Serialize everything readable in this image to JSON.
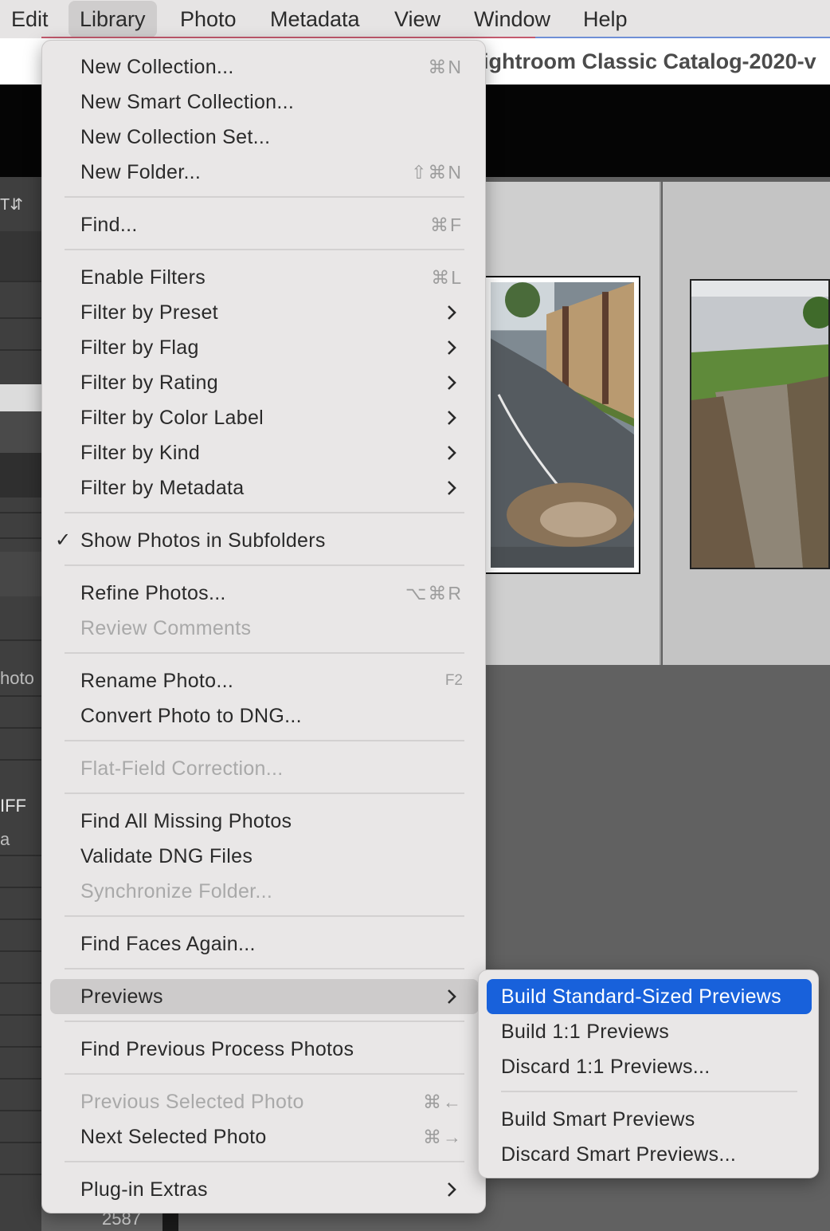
{
  "menubar": {
    "items": [
      {
        "label": "Edit"
      },
      {
        "label": "Library"
      },
      {
        "label": "Photo"
      },
      {
        "label": "Metadata"
      },
      {
        "label": "View"
      },
      {
        "label": "Window"
      },
      {
        "label": "Help"
      }
    ],
    "active": "Library"
  },
  "window": {
    "title": "ightroom Classic Catalog-2020-v"
  },
  "background": {
    "left_panel_texts": [
      "hoto",
      "IFF",
      "a"
    ],
    "filmstrip_count": "2587"
  },
  "library_menu": {
    "items": [
      {
        "label": "New Collection...",
        "shortcut": "⌘N"
      },
      {
        "label": "New Smart Collection..."
      },
      {
        "label": "New Collection Set..."
      },
      {
        "label": "New Folder...",
        "shortcut": "⇧⌘N"
      },
      {
        "label": "Find...",
        "shortcut": "⌘F"
      },
      {
        "label": "Enable Filters",
        "shortcut": "⌘L"
      },
      {
        "label": "Filter by Preset"
      },
      {
        "label": "Filter by Flag"
      },
      {
        "label": "Filter by Rating"
      },
      {
        "label": "Filter by Color Label"
      },
      {
        "label": "Filter by Kind"
      },
      {
        "label": "Filter by Metadata"
      },
      {
        "label": "Show Photos in Subfolders",
        "checked": true,
        "check_mark": "✓"
      },
      {
        "label": "Refine Photos...",
        "shortcut": "⌥⌘R"
      },
      {
        "label": "Review Comments",
        "disabled": true
      },
      {
        "label": "Rename Photo...",
        "shortcut": "F2"
      },
      {
        "label": "Convert Photo to DNG..."
      },
      {
        "label": "Flat-Field Correction...",
        "disabled": true
      },
      {
        "label": "Find All Missing Photos"
      },
      {
        "label": "Validate DNG Files"
      },
      {
        "label": "Synchronize Folder...",
        "disabled": true
      },
      {
        "label": "Find Faces Again..."
      },
      {
        "label": "Previews",
        "highlighted": true
      },
      {
        "label": "Find Previous Process Photos"
      },
      {
        "label": "Previous Selected Photo",
        "shortcut": "⌘←",
        "disabled": true
      },
      {
        "label": "Next Selected Photo",
        "shortcut": "⌘→"
      },
      {
        "label": "Plug-in Extras"
      }
    ]
  },
  "previews_submenu": {
    "items": [
      {
        "label": "Build Standard-Sized Previews",
        "selected": true
      },
      {
        "label": "Build 1:1 Previews"
      },
      {
        "label": "Discard 1:1 Previews..."
      },
      {
        "label": "Build Smart Previews"
      },
      {
        "label": "Discard Smart Previews..."
      }
    ]
  },
  "colors": {
    "selection": "#1861db",
    "menu_bg": "#e9e7e7",
    "hover": "#cdcbcb"
  },
  "icons": {
    "submenu_arrow": "chevron-right-icon",
    "check": "checkmark-icon"
  }
}
